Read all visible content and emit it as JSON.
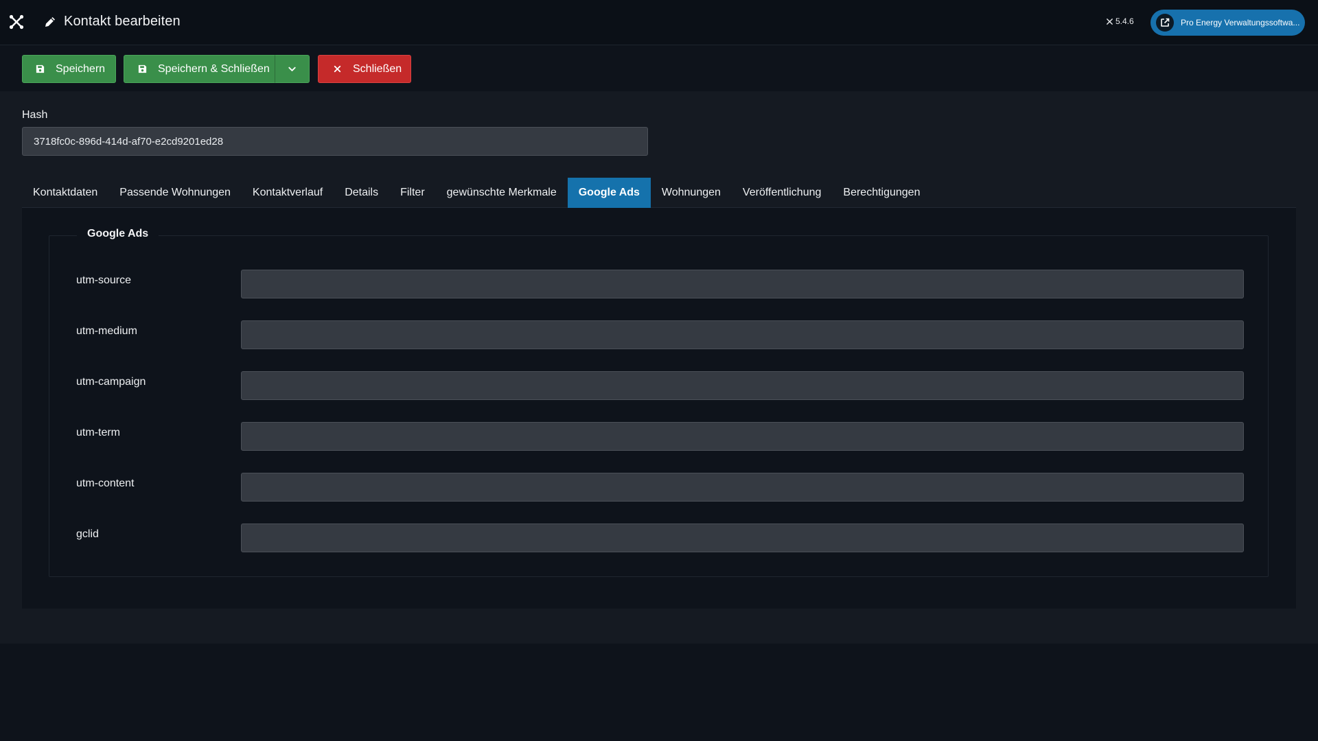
{
  "header": {
    "title": "Kontakt bearbeiten",
    "version": "5.4.6",
    "site_button": "Pro Energy Verwaltungssoftwa..."
  },
  "toolbar": {
    "save": "Speichern",
    "save_close": "Speichern & Schließen",
    "close": "Schließen"
  },
  "form": {
    "hash_label": "Hash",
    "hash_value": "3718fc0c-896d-414d-af70-e2cd9201ed28"
  },
  "tabs": [
    {
      "label": "Kontaktdaten"
    },
    {
      "label": "Passende Wohnungen"
    },
    {
      "label": "Kontaktverlauf"
    },
    {
      "label": "Details"
    },
    {
      "label": "Filter"
    },
    {
      "label": "gewünschte Merkmale"
    },
    {
      "label": "Google Ads"
    },
    {
      "label": "Wohnungen"
    },
    {
      "label": "Veröffentlichung"
    },
    {
      "label": "Berechtigungen"
    }
  ],
  "active_tab": "Google Ads",
  "google_ads": {
    "legend": "Google Ads",
    "fields": [
      {
        "label": "utm-source",
        "value": ""
      },
      {
        "label": "utm-medium",
        "value": ""
      },
      {
        "label": "utm-campaign",
        "value": ""
      },
      {
        "label": "utm-term",
        "value": ""
      },
      {
        "label": "utm-content",
        "value": ""
      },
      {
        "label": "gclid",
        "value": ""
      }
    ]
  },
  "colors": {
    "accent": "#1572ac",
    "success": "#3a8f4a",
    "danger": "#c52a2a"
  },
  "icons": [
    "joomla-logo-icon",
    "pencil-icon",
    "external-link-icon",
    "save-icon",
    "chevron-down-icon",
    "close-icon"
  ]
}
